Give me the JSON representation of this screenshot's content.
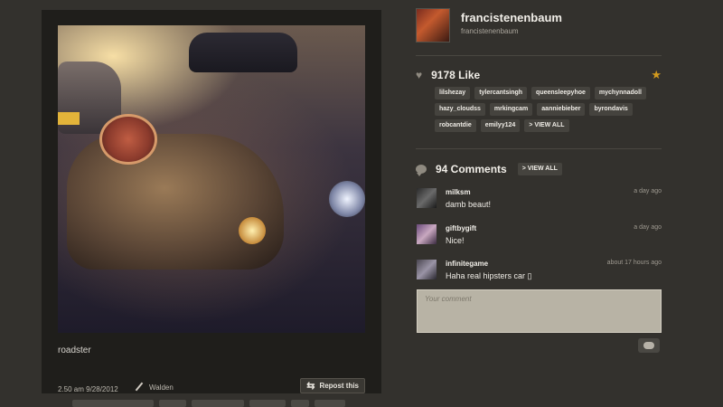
{
  "post": {
    "caption": "roadster",
    "time": "2.50 am 9/28/2012",
    "filter": "Walden",
    "repost_label": "Repost this"
  },
  "profile": {
    "username": "francistenenbaum",
    "handle": "francistenenbaum"
  },
  "likes": {
    "count_label": "9178 Like",
    "likers": [
      "lilshezay",
      "tylercantsingh",
      "queensleepyhoe",
      "mychynnadoll",
      "hazy_cloudss",
      "mrkingcam",
      "aanniebieber",
      "byrondavis",
      "robcantdie",
      "emilyy124"
    ],
    "view_all": "> VIEW ALL"
  },
  "comments": {
    "count_label": "94 Comments",
    "view_all": "> VIEW ALL",
    "items": [
      {
        "user": "milksm",
        "time": "a day ago",
        "text": "damb beaut!"
      },
      {
        "user": "giftbygift",
        "time": "a day ago",
        "text": "Nice!"
      },
      {
        "user": "infinitegame",
        "time": "about 17 hours ago",
        "text": "Haha real hipsters car ▯"
      }
    ],
    "input_placeholder": "Your comment"
  },
  "icons": {
    "like": "heart-icon",
    "favorite": "star-icon",
    "comments": "speech-bubble-icon",
    "repost": "repost-icon",
    "filter": "brush-icon",
    "send": "send-bubble-icon"
  },
  "colors": {
    "background": "#33312d",
    "card": "#1f1e1b",
    "tag": "#45433e",
    "star": "#d29a1e",
    "comment_box": "#b8b3a5"
  }
}
